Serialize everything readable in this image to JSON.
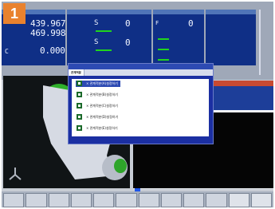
{
  "badge": "1",
  "axes": {
    "x_value": "439.967",
    "z_value": "469.998",
    "c_label": "C",
    "c_value": "0.000"
  },
  "spindle": {
    "s_label": "S",
    "s_value": "0",
    "s2_label": "S",
    "s2_value": "0"
  },
  "feed": {
    "f_label": "F",
    "f_value": "0"
  },
  "dialog": {
    "tab_active": "관계적분",
    "items": [
      "× 관계적분(A)설정하기",
      "× 관계적분(B)설정하기",
      "× 관계적분(C)설정하기",
      "× 관계적분(D)설정하기",
      "× 관계적분(E)설정하기"
    ]
  },
  "softkeys": [
    "",
    "",
    "",
    "",
    "",
    "",
    "",
    "",
    "",
    "",
    "",
    ""
  ]
}
